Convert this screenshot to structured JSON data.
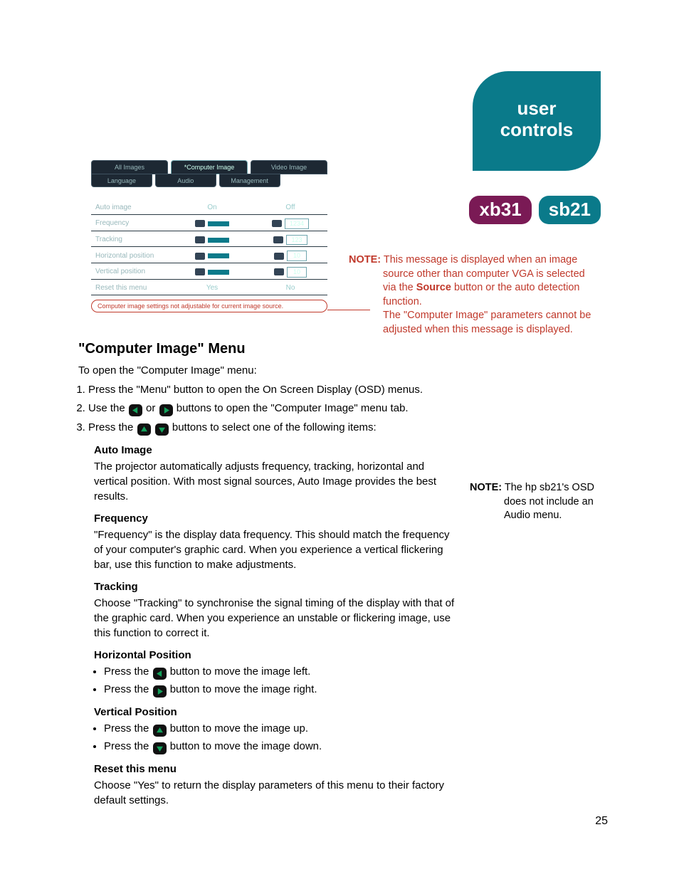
{
  "header": {
    "tab_line1": "user",
    "tab_line2": "controls",
    "badge_xb": "xb31",
    "badge_sb": "sb21"
  },
  "osd": {
    "tabs_top": [
      "All Images",
      "*Computer Image",
      "Video Image"
    ],
    "tabs_bottom": [
      "Language",
      "Audio",
      "Management"
    ],
    "rows": {
      "auto_image": {
        "label": "Auto image",
        "opt_on": "On",
        "opt_off": "Off"
      },
      "frequency": {
        "label": "Frequency",
        "value": "1234"
      },
      "tracking": {
        "label": "Tracking",
        "value": "123"
      },
      "hpos": {
        "label": "Horizontal position",
        "value": "10"
      },
      "vpos": {
        "label": "Vertical position",
        "value": "10"
      },
      "reset": {
        "label": "Reset this menu",
        "opt_yes": "Yes",
        "opt_no": "No"
      }
    },
    "warning": "Computer image settings not adjustable for current image source."
  },
  "note1": {
    "label": "NOTE:",
    "l1": " This message is displayed when an image",
    "l2": "source other than computer VGA is selected",
    "l3_a": "via the ",
    "l3_src": "Source",
    "l3_b": " button or the auto detection",
    "l4": "function.",
    "l5": "The \"Computer Image\" parameters cannot be",
    "l6": "adjusted when this message is displayed."
  },
  "note2": {
    "label": "NOTE:",
    "l1": " The hp sb21's OSD",
    "l2": "does not include an",
    "l3": "Audio menu."
  },
  "content": {
    "h2": "\"Computer Image\" Menu",
    "intro": "To open the \"Computer Image\" menu:",
    "step1": "Press the \"Menu\" button to open the On Screen Display (OSD) menus.",
    "step2_a": "Use the ",
    "step2_b": " or ",
    "step2_c": " buttons to open the \"Computer Image\" menu tab.",
    "step3_a": "Press the ",
    "step3_b": " buttons to select one of the following items:",
    "auto_head": "Auto Image",
    "auto_body": "The projector automatically adjusts frequency, tracking, horizontal and vertical position. With most signal sources, Auto Image provides the best results.",
    "freq_head": "Frequency",
    "freq_body": "\"Frequency\" is the display data frequency. This should match the frequency of your computer's graphic card. When you experience a vertical flickering bar, use this function to make adjustments.",
    "track_head": "Tracking",
    "track_body": "Choose \"Tracking\" to synchronise the signal timing of the display with that of the graphic card. When you experience an unstable or flickering image, use this function to correct it.",
    "hpos_head": "Horizontal Position",
    "hpos_l1_a": "Press the ",
    "hpos_l1_b": " button to move the image left.",
    "hpos_l2_a": "Press the ",
    "hpos_l2_b": " button to move the image right.",
    "vpos_head": "Vertical Position",
    "vpos_l1_a": "Press the ",
    "vpos_l1_b": " button to move the image up.",
    "vpos_l2_a": "Press the ",
    "vpos_l2_b": " button to move the image down.",
    "reset_head": "Reset this menu",
    "reset_body": "Choose \"Yes\" to return the display parameters of this menu to their factory default settings."
  },
  "page_number": "25"
}
